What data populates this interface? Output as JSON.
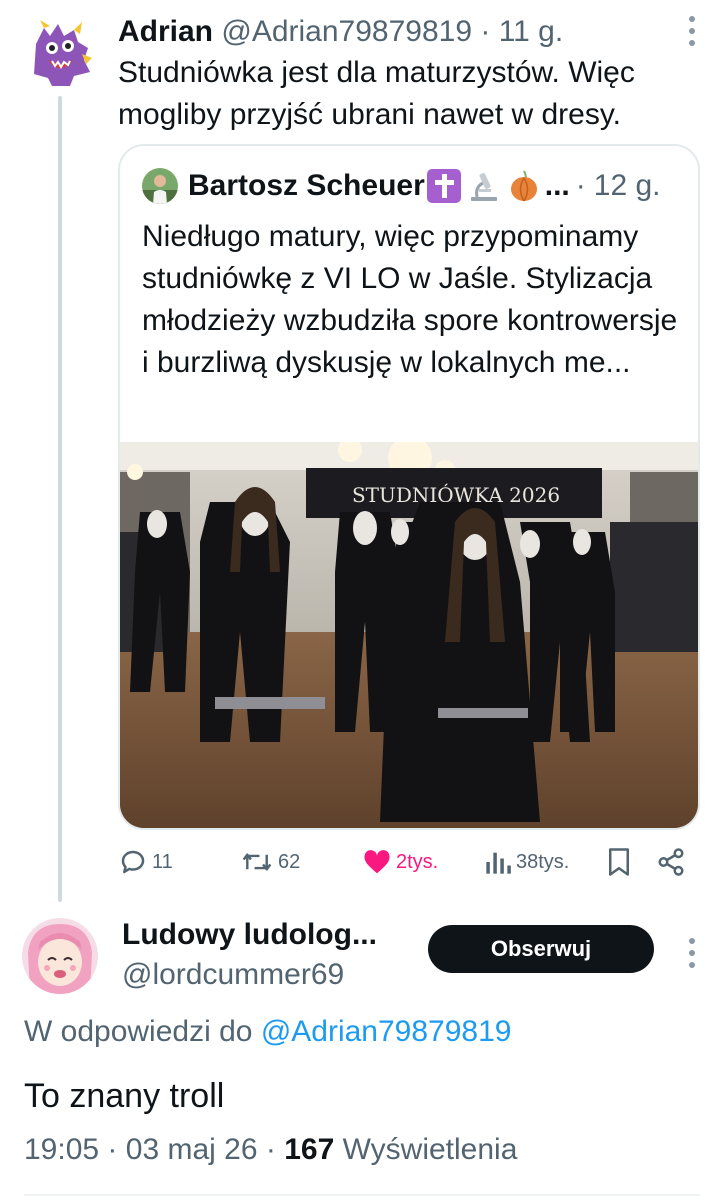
{
  "parent_tweet": {
    "author_name": "Adrian",
    "handle": "@Adrian79879819",
    "separator": "·",
    "time": "11 g.",
    "text": "Studniówka jest dla maturzystów. Więc mogliby przyjść ubrani nawet w dresy.",
    "avatar_icon": "purple-monster-avatar"
  },
  "quoted_tweet": {
    "author_name": "Bartosz Scheuer",
    "name_emojis": [
      "latin-cross-emoji",
      "microscope-emoji",
      "onion-emoji"
    ],
    "ellipsis": "...",
    "separator": "·",
    "time": "12 g.",
    "text": "Niedługo matury, więc przypominamy studniówkę z VI LO w Jaśle. Stylizacja młodzieży wzbudziła spore kontrowersje i burzliwą dyskusję w lokalnych me...",
    "image": {
      "banner_text": "STUDNIÓWKA 2026",
      "description_icon": "ballroom-photo"
    }
  },
  "actions": {
    "replies": "11",
    "retweets": "62",
    "likes": "2tys.",
    "views": "38tys.",
    "colors": {
      "like": "#f91880",
      "default": "#536471"
    }
  },
  "reply": {
    "author_name": "Ludowy ludolog...",
    "handle": "@lordcummer69",
    "follow_label": "Obserwuj",
    "reply_to_prefix": "W odpowiedzi do",
    "reply_to_handle": "@Adrian79879819",
    "text": "To znany troll",
    "time": "19:05",
    "separator": "·",
    "date": "03 maj 26",
    "separator2": "·",
    "views_count": "167",
    "views_label": "Wyświetlenia",
    "avatar_icon": "pink-hair-anime-avatar"
  },
  "colors": {
    "link": "#1d9bf0",
    "text_primary": "#0f1419",
    "text_secondary": "#536471",
    "button_bg": "#0f1419"
  }
}
